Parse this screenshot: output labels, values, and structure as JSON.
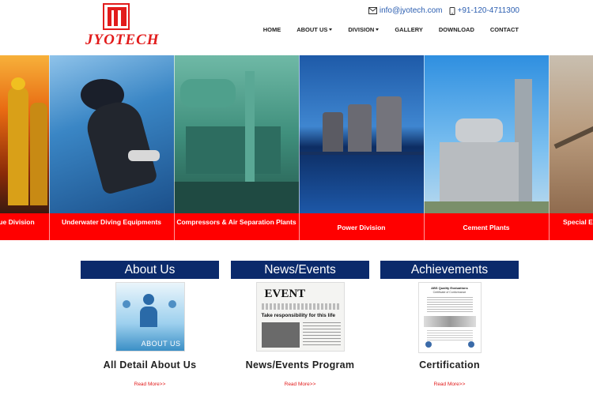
{
  "brand": {
    "name": "JYOTECH"
  },
  "contact": {
    "email": "info@jyotech.com",
    "phone": "+91-120-4711300"
  },
  "nav": {
    "items": [
      {
        "label": "HOME",
        "caret": false
      },
      {
        "label": "ABOUT US",
        "caret": true
      },
      {
        "label": "DIVISION",
        "caret": true
      },
      {
        "label": "GALLERY",
        "caret": false
      },
      {
        "label": "DOWNLOAD",
        "caret": false
      },
      {
        "label": "CONTACT",
        "caret": false
      }
    ]
  },
  "slider": {
    "tiles": [
      {
        "label": "ue Division"
      },
      {
        "label": "Underwater Diving Equipments"
      },
      {
        "label": "Compressors & Air Separation Plants"
      },
      {
        "label": "Power Division"
      },
      {
        "label": "Cement Plants"
      },
      {
        "label": "Special E"
      }
    ]
  },
  "sections": [
    {
      "heading": "About Us",
      "title": "All Detail About Us",
      "link": "Read More>>",
      "thumb_text": "ABOUT US"
    },
    {
      "heading": "News/Events",
      "title": "News/Events Program",
      "link": "Read More>>",
      "thumb_text": "EVENT",
      "thumb_sub": "Take responsibility for this life"
    },
    {
      "heading": "Achievements",
      "title": "Certification",
      "link": "Read More>>",
      "thumb_text": "ABS Quality Evaluations",
      "thumb_sub": "Certificate of Conformance"
    }
  ],
  "colors": {
    "brand_red": "#e21b1b",
    "caption_red": "#ff0000",
    "heading_navy": "#0b2a6b",
    "link_blue": "#2a5db0"
  }
}
